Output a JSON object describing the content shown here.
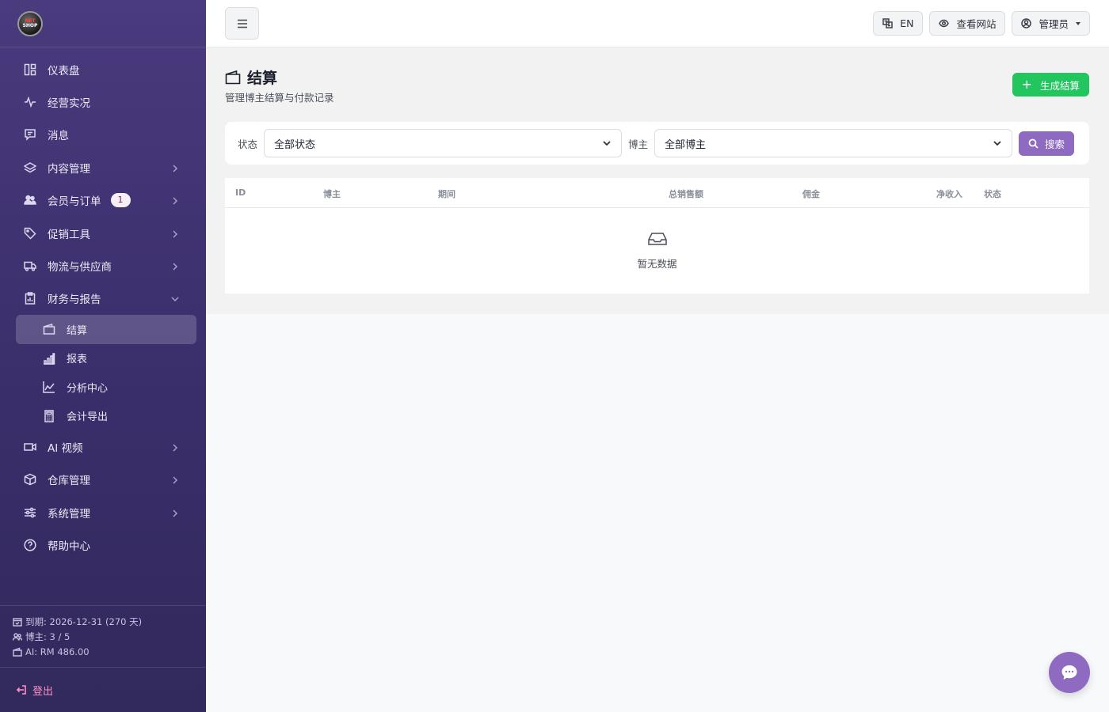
{
  "sidebar": {
    "logo": {
      "line1": "NET",
      "line2": "SHOP"
    },
    "items": [
      {
        "label": "仪表盘",
        "icon": "layout-icon"
      },
      {
        "label": "经营实况",
        "icon": "activity-icon"
      },
      {
        "label": "消息",
        "icon": "message-icon"
      },
      {
        "label": "内容管理",
        "icon": "layers-icon"
      },
      {
        "label": "会员与订单",
        "icon": "users-icon",
        "badge": "1"
      },
      {
        "label": "促销工具",
        "icon": "tag-icon"
      },
      {
        "label": "物流与供应商",
        "icon": "truck-icon"
      },
      {
        "label": "财务与报告",
        "icon": "clipboard-icon"
      },
      {
        "label": "AI 视频",
        "icon": "video-icon"
      },
      {
        "label": "仓库管理",
        "icon": "box-icon"
      },
      {
        "label": "系统管理",
        "icon": "sliders-icon"
      },
      {
        "label": "帮助中心",
        "icon": "help-icon"
      }
    ],
    "finance_sub": [
      {
        "label": "结算",
        "icon": "wallet-icon"
      },
      {
        "label": "报表",
        "icon": "bar-chart-icon"
      },
      {
        "label": "分析中心",
        "icon": "line-chart-icon"
      },
      {
        "label": "会计导出",
        "icon": "calculator-icon"
      }
    ],
    "info": {
      "expiry": "到期: 2026-12-31 (270 天)",
      "bloggers": "博主: 3 / 5",
      "ai": "AI: RM 486.00"
    },
    "logout": "登出"
  },
  "topbar": {
    "lang": "EN",
    "view_site": "查看网站",
    "admin": "管理员"
  },
  "page": {
    "title": "结算",
    "subtitle": "管理博主结算与付款记录",
    "generate_button": "生成结算"
  },
  "filter": {
    "status_label": "状态",
    "status_value": "全部状态",
    "blogger_label": "博主",
    "blogger_value": "全部博主",
    "search_button": "搜索"
  },
  "table": {
    "columns": [
      "ID",
      "博主",
      "期间",
      "总销售额",
      "佣金",
      "净收入",
      "状态"
    ],
    "empty_text": "暂无数据"
  },
  "colors": {
    "sidebar_top": "#4a3a7e",
    "accent_green": "#22c55e",
    "accent_purple": "#8f6ac1"
  }
}
